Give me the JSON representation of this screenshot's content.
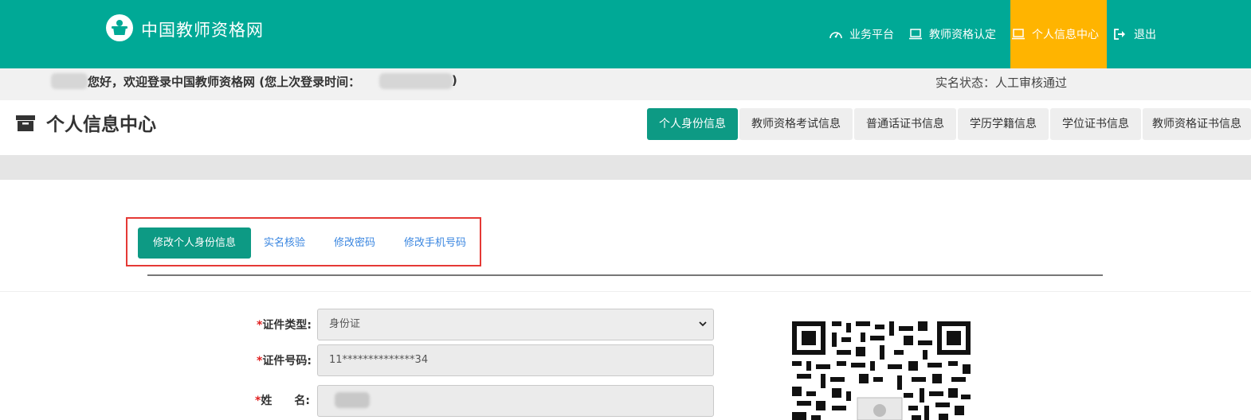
{
  "header": {
    "site_title": "中国教师资格网",
    "logo_icon": "teacher-logo-icon",
    "brand_color": "#00a996",
    "nav": [
      {
        "label": "业务平台",
        "icon": "dashboard-icon",
        "active": false
      },
      {
        "label": "教师资格认定",
        "icon": "laptop-icon",
        "active": false
      },
      {
        "label": "个人信息中心",
        "icon": "laptop-icon",
        "active": true
      },
      {
        "label": "退出",
        "icon": "logout-icon",
        "active": false
      }
    ],
    "active_color": "#ffb400"
  },
  "greeting": {
    "text": "您好，欢迎登录中国教师资格网 (您上次登录时间：",
    "close": ")",
    "realname_status": "实名状态：人工审核通过"
  },
  "page": {
    "title": "个人信息中心",
    "title_icon": "archive-icon",
    "tabs": [
      {
        "label": "个人身份信息",
        "active": true
      },
      {
        "label": "教师资格考试信息",
        "active": false
      },
      {
        "label": "普通话证书信息",
        "active": false
      },
      {
        "label": "学历学籍信息",
        "active": false
      },
      {
        "label": "学位证书信息",
        "active": false
      },
      {
        "label": "教师资格证书信息",
        "active": false
      }
    ]
  },
  "subtabs": [
    {
      "label": "修改个人身份信息",
      "active": true
    },
    {
      "label": "实名核验",
      "active": false
    },
    {
      "label": "修改密码",
      "active": false
    },
    {
      "label": "修改手机号码",
      "active": false
    }
  ],
  "form": {
    "id_type": {
      "required": "*",
      "label": "证件类型:",
      "value": "身份证"
    },
    "id_number": {
      "required": "*",
      "label": "证件号码:",
      "value": "11**************34"
    },
    "name": {
      "required": "*",
      "label": "姓　　名:",
      "value": ""
    }
  },
  "qr_icon": "qr-code-icon"
}
